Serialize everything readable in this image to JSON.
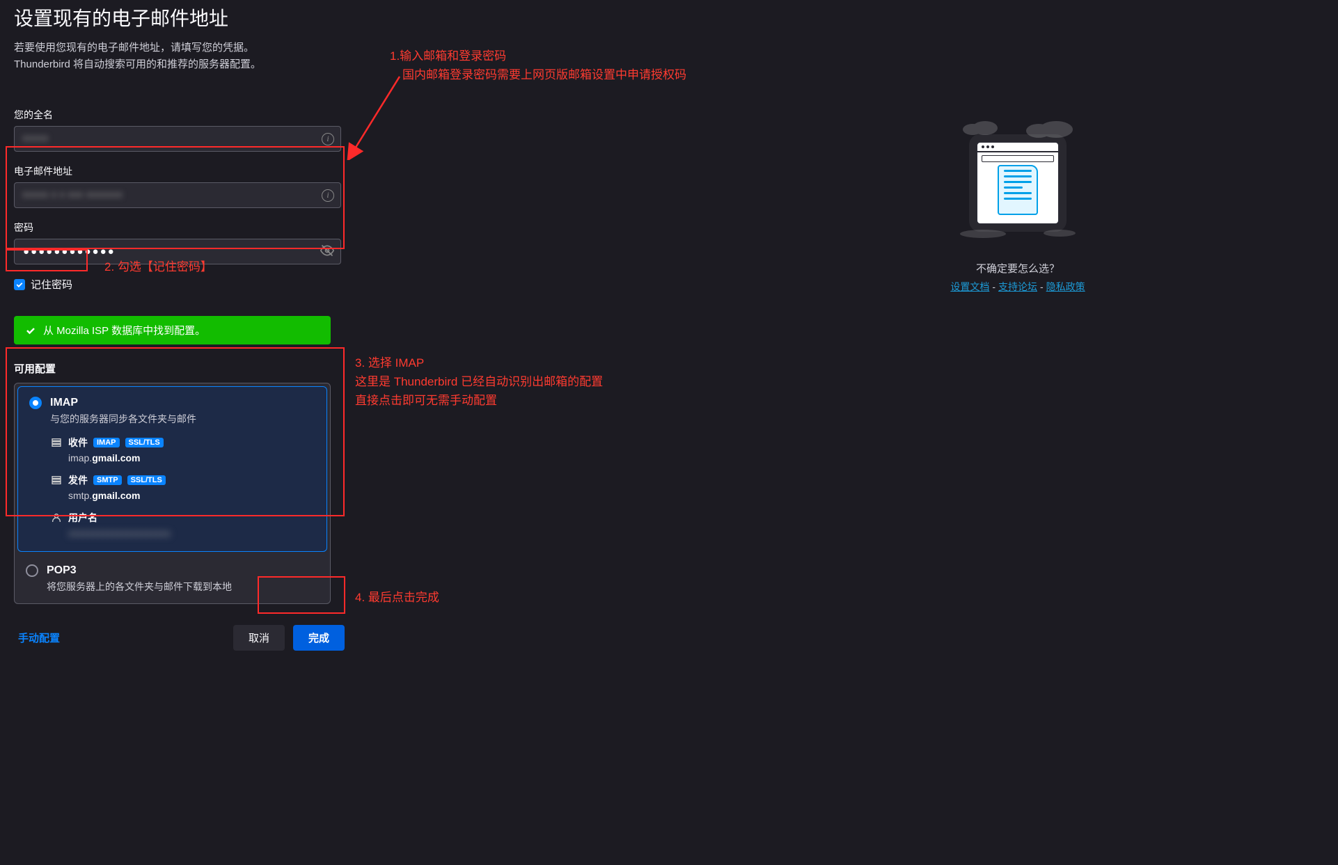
{
  "title": "设置现有的电子邮件地址",
  "subtitle_l1": "若要使用您现有的电子邮件地址，请填写您的凭据。",
  "subtitle_l2": "Thunderbird 将自动搜索可用的和推荐的服务器配置。",
  "annot": {
    "a1_l1": "1.输入邮箱和登录密码",
    "a1_l2": "国内邮箱登录密码需要上网页版邮箱设置中申请授权码",
    "a2": "2. 勾选【记住密码】",
    "a3_l1": "3. 选择 IMAP",
    "a3_l2": "这里是 Thunderbird 已经自动识别出邮箱的配置",
    "a3_l3": "直接点击即可无需手动配置",
    "a4": "4. 最后点击完成"
  },
  "form": {
    "fullname_label": "您的全名",
    "fullname_value": "xxxxx",
    "email_label": "电子邮件地址",
    "email_value": "xxxxx x x xxx xxxxxxx",
    "password_label": "密码",
    "password_value": "●●●●●●●●●●●●",
    "remember_label": "记住密码"
  },
  "banner": "从 Mozilla ISP 数据库中找到配置。",
  "avail_label": "可用配置",
  "imap": {
    "title": "IMAP",
    "desc": "与您的服务器同步各文件夹与邮件",
    "in_label": "收件",
    "in_tag1": "IMAP",
    "in_tag2": "SSL/TLS",
    "in_host_pre": "imap.",
    "in_host_b": "gmail.com",
    "out_label": "发件",
    "out_tag1": "SMTP",
    "out_tag2": "SSL/TLS",
    "out_host_pre": "smtp.",
    "out_host_b": "gmail.com",
    "user_label": "用户名",
    "user_value": "xxxxxxxxxxxxxxxxxxxxx"
  },
  "pop3": {
    "title": "POP3",
    "desc": "将您服务器上的各文件夹与邮件下载到本地"
  },
  "actions": {
    "manual": "手动配置",
    "cancel": "取消",
    "done": "完成"
  },
  "help": {
    "prompt": "不确定要怎么选？",
    "link1": "设置文档",
    "link2": "支持论坛",
    "link3": "隐私政策"
  }
}
